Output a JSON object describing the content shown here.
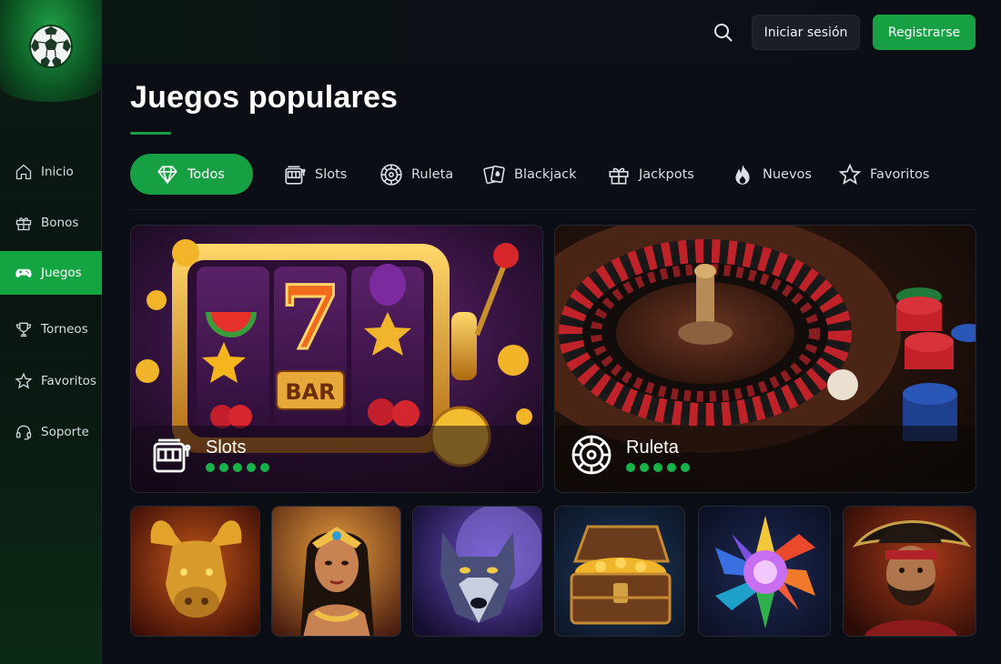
{
  "brand": {
    "logo_icon": "soccer-ball-icon"
  },
  "sidebar": {
    "items": [
      {
        "label": "Inicio",
        "icon": "home-icon"
      },
      {
        "label": "Bonos",
        "icon": "gift-icon"
      },
      {
        "label": "Juegos",
        "icon": "gamepad-icon",
        "active": true
      },
      {
        "label": "Torneos",
        "icon": "trophy-icon"
      },
      {
        "label": "Favoritos",
        "icon": "star-icon"
      },
      {
        "label": "Soporte",
        "icon": "headset-icon"
      }
    ]
  },
  "header": {
    "search_icon": "search-icon",
    "login_label": "Iniciar sesión",
    "register_label": "Registrarse"
  },
  "main": {
    "title": "Juegos populares",
    "tabs": [
      {
        "label": "Todos",
        "icon": "diamond-icon",
        "active": true
      },
      {
        "label": "Slots",
        "icon": "slot-machine-icon"
      },
      {
        "label": "Ruleta",
        "icon": "roulette-icon"
      },
      {
        "label": "Blackjack",
        "icon": "cards-icon"
      },
      {
        "label": "Jackpots",
        "icon": "gift-icon"
      },
      {
        "label": "Nuevos",
        "icon": "flame-icon"
      },
      {
        "label": "Favoritos",
        "icon": "star-icon"
      }
    ],
    "featured": [
      {
        "name": "Slots",
        "icon": "slot-machine-icon",
        "rating": 5
      },
      {
        "name": "Ruleta",
        "icon": "roulette-icon",
        "rating": 5
      }
    ],
    "thumbnails": [
      {
        "subject": "golden-bull"
      },
      {
        "subject": "egyptian-queen"
      },
      {
        "subject": "wolf"
      },
      {
        "subject": "treasure-chest"
      },
      {
        "subject": "gem-star"
      },
      {
        "subject": "pirate"
      }
    ]
  },
  "colors": {
    "accent": "#16a043",
    "background": "#0b0f15",
    "surface": "#1a1f27"
  }
}
